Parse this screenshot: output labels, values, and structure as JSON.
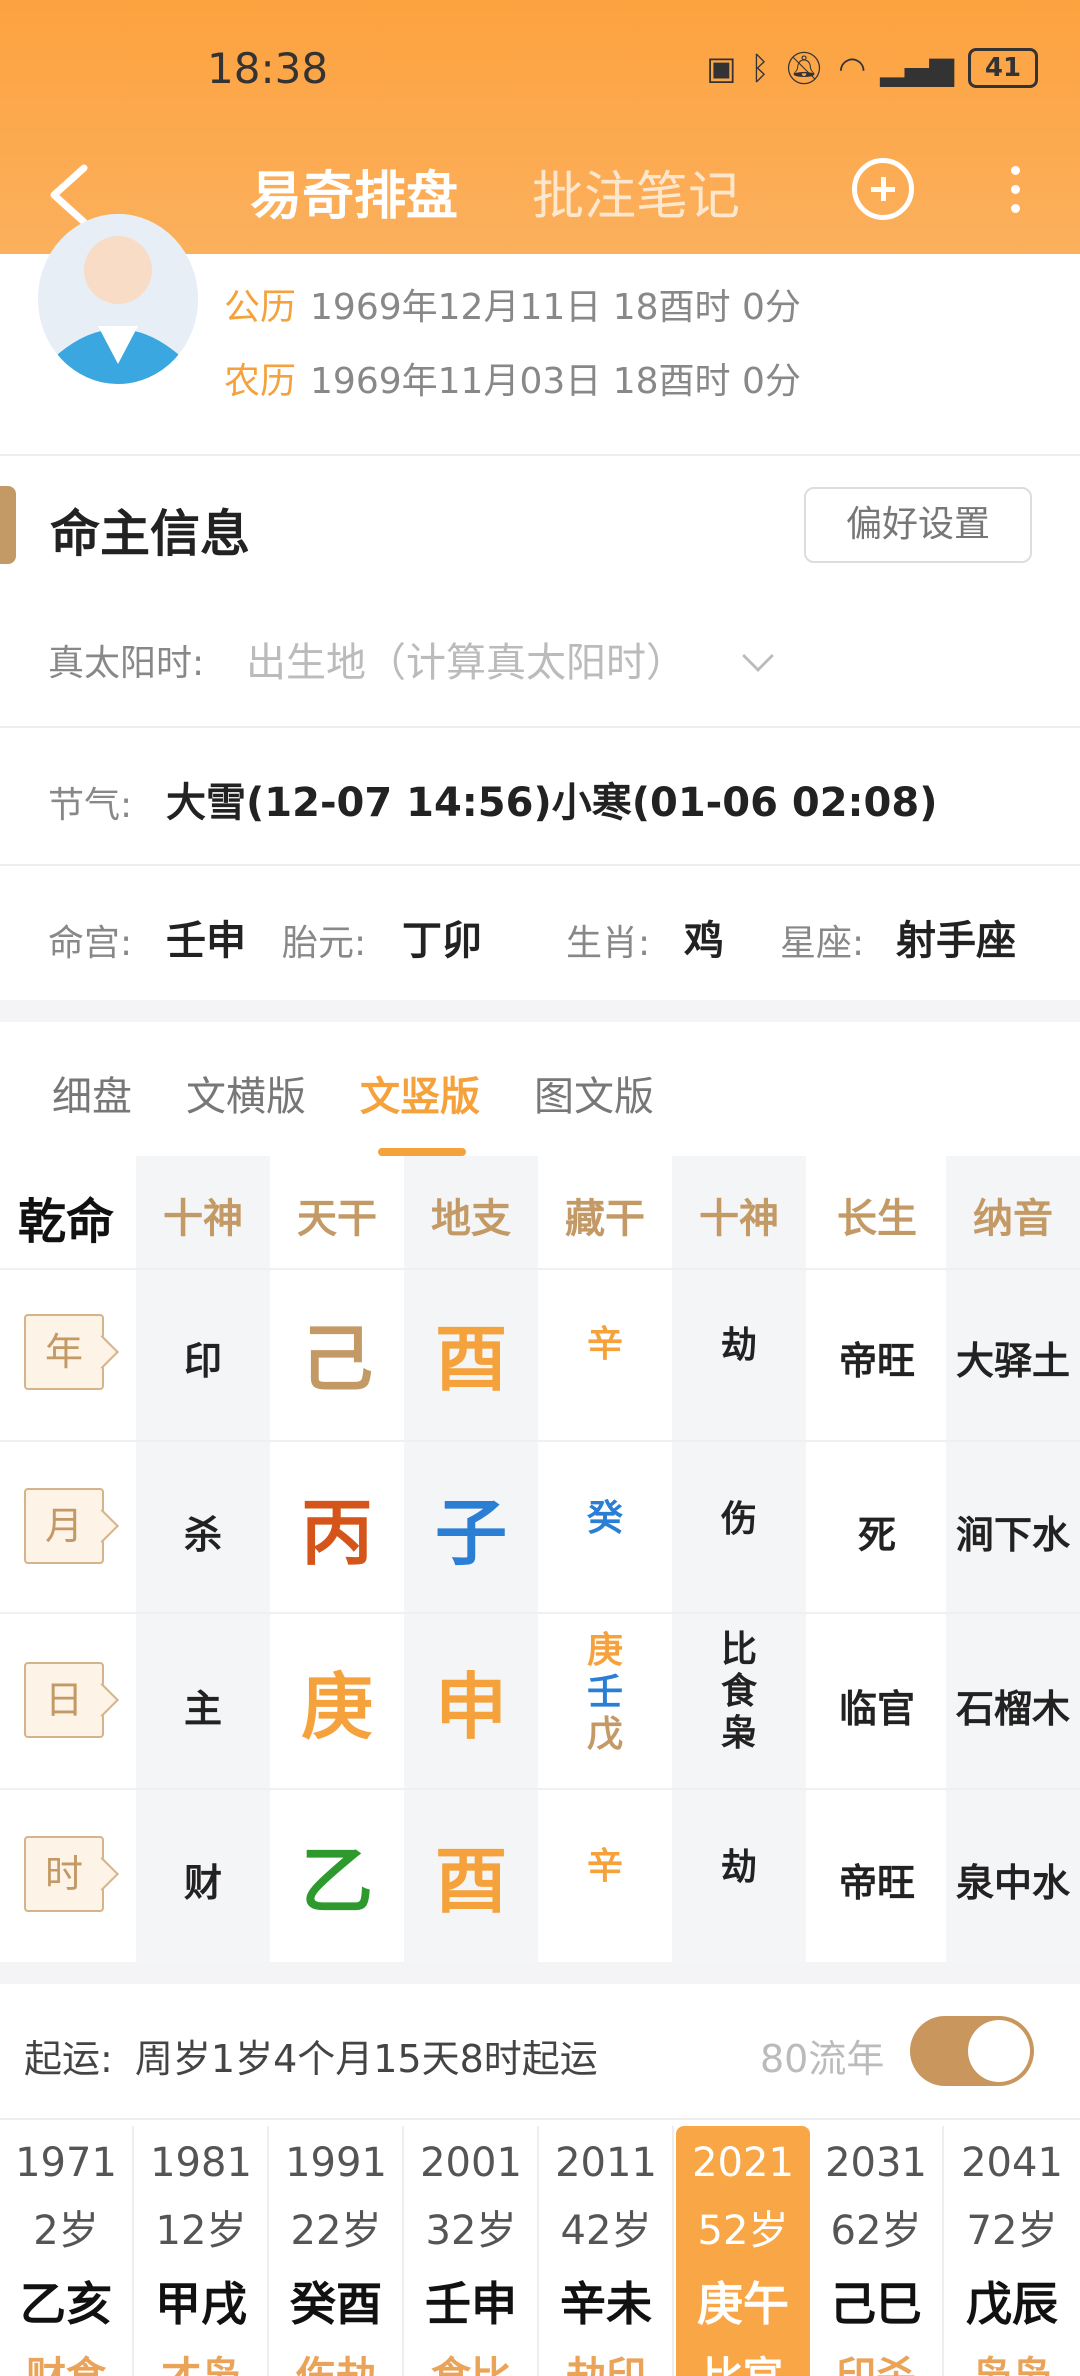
{
  "status_bar": {
    "time": "18:38",
    "battery": "41",
    "icons": [
      "nfc-icon",
      "bluetooth-icon",
      "mute-icon",
      "wifi-icon",
      "signal-5g-icon"
    ]
  },
  "nav": {
    "tab_active": "易奇排盘",
    "tab_other": "批注笔记"
  },
  "profile": {
    "solar_label": "公历",
    "solar_value": "1969年12月11日 18酉时 0分",
    "lunar_label": "农历",
    "lunar_value": "1969年11月03日 18酉时 0分"
  },
  "info": {
    "title": "命主信息",
    "pref_button": "偏好设置",
    "true_sun_label": "真太阳时:",
    "true_sun_placeholder": "出生地（计算真太阳时）",
    "jieqi_label": "节气:",
    "jieqi_value": "大雪(12-07 14:56)小寒(01-06 02:08)",
    "minggong_label": "命宫:",
    "minggong_value": "壬申",
    "taiyuan_label": "胎元:",
    "taiyuan_value": "丁卯",
    "shengxiao_label": "生肖:",
    "shengxiao_value": "鸡",
    "xingzuo_label": "星座:",
    "xingzuo_value": "射手座"
  },
  "view_tabs": [
    "细盘",
    "文横版",
    "文竖版",
    "图文版"
  ],
  "view_tab_active": "文竖版",
  "grid": {
    "corner": "乾命",
    "headers": [
      "十神",
      "天干",
      "地支",
      "藏干",
      "十神",
      "长生",
      "纳音"
    ],
    "rows": [
      {
        "pillar": "年",
        "shishen": "印",
        "tiangan": "己",
        "dizhi": "酉",
        "canggan": [
          "辛"
        ],
        "shishen2": [
          "劫"
        ],
        "changsheng": "帝旺",
        "nayin": "大驿土"
      },
      {
        "pillar": "月",
        "shishen": "杀",
        "tiangan": "丙",
        "dizhi": "子",
        "canggan": [
          "癸"
        ],
        "shishen2": [
          "伤"
        ],
        "changsheng": "死",
        "nayin": "涧下水"
      },
      {
        "pillar": "日",
        "shishen": "主",
        "tiangan": "庚",
        "dizhi": "申",
        "canggan": [
          "庚",
          "壬",
          "戊"
        ],
        "shishen2": [
          "比",
          "食",
          "枭"
        ],
        "changsheng": "临官",
        "nayin": "石榴木"
      },
      {
        "pillar": "时",
        "shishen": "财",
        "tiangan": "乙",
        "dizhi": "酉",
        "canggan": [
          "辛"
        ],
        "shishen2": [
          "劫"
        ],
        "changsheng": "帝旺",
        "nayin": "泉中水"
      }
    ],
    "colors": {
      "earth": "#c39a66",
      "metal": "#f5a23d",
      "fire": "#d4541a",
      "water": "#2a7fd4",
      "wood": "#2e9a2e"
    }
  },
  "qiyun": {
    "label": "起运:",
    "value": "周岁1岁4个月15天8时起运",
    "liunian_label": "80流年",
    "toggle_on": true
  },
  "dayun": [
    {
      "year": "1971",
      "age": "2岁",
      "ganzhi": "乙亥",
      "extra": "财食"
    },
    {
      "year": "1981",
      "age": "12岁",
      "ganzhi": "甲戌",
      "extra": "才枭"
    },
    {
      "year": "1991",
      "age": "22岁",
      "ganzhi": "癸酉",
      "extra": "伤劫"
    },
    {
      "year": "2001",
      "age": "32岁",
      "ganzhi": "壬申",
      "extra": "食比"
    },
    {
      "year": "2011",
      "age": "42岁",
      "ganzhi": "辛未",
      "extra": "劫印"
    },
    {
      "year": "2021",
      "age": "52岁",
      "ganzhi": "庚午",
      "extra": "比官"
    },
    {
      "year": "2031",
      "age": "62岁",
      "ganzhi": "己巳",
      "extra": "印杀"
    },
    {
      "year": "2041",
      "age": "72岁",
      "ganzhi": "戊辰",
      "extra": "枭枭"
    }
  ]
}
